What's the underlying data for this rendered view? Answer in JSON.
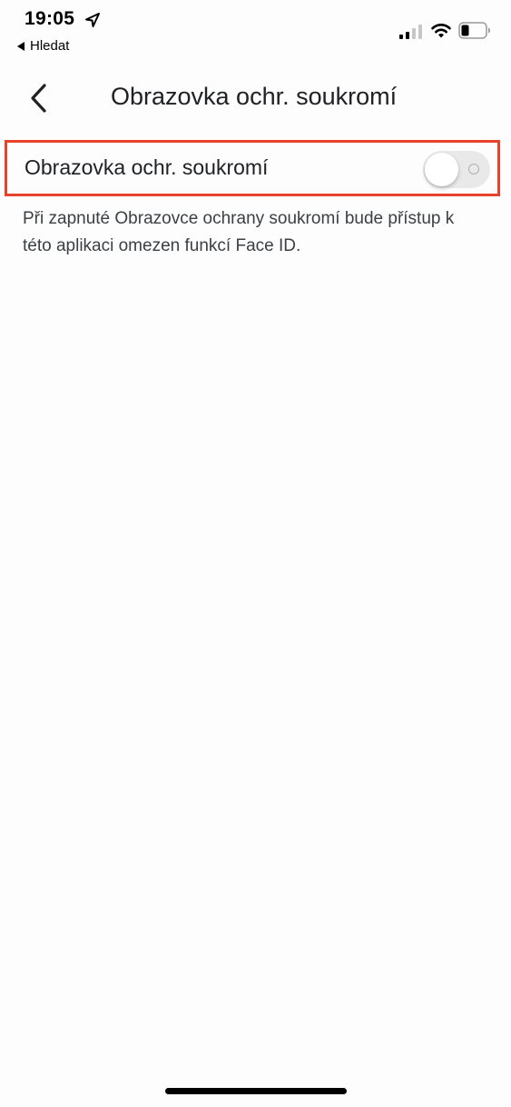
{
  "status_bar": {
    "time": "19:05",
    "back_to_app": "Hledat",
    "icons": [
      "location-icon",
      "signal-icon",
      "wifi-icon",
      "battery-icon"
    ],
    "signal_bars_active": 2
  },
  "header": {
    "back_icon": "chevron-left-icon",
    "title": "Obrazovka ochr. soukromí"
  },
  "setting": {
    "label": "Obrazovka ochr. soukromí",
    "toggle_on": false,
    "highlight_color": "#e8412c"
  },
  "description": "Při zapnuté Obrazovce ochrany soukromí bude přístup k této aplikaci omezen funkcí Face ID."
}
